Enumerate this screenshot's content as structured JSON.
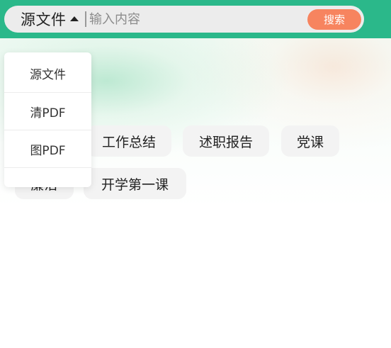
{
  "search": {
    "type_selected": "源文件",
    "placeholder": "输入内容",
    "button_label": "搜索"
  },
  "dropdown": {
    "items": [
      {
        "label": "源文件"
      },
      {
        "label": "清PDF"
      },
      {
        "label": "图PDF"
      }
    ]
  },
  "tags": [
    {
      "label": "工作总结"
    },
    {
      "label": "述职报告"
    },
    {
      "label": "党课"
    },
    {
      "label": "廉洁"
    },
    {
      "label": "开学第一课"
    }
  ],
  "colors": {
    "header": "#2bb88a",
    "search_button": "#f7845f",
    "tag_bg": "#f3f3f3"
  }
}
